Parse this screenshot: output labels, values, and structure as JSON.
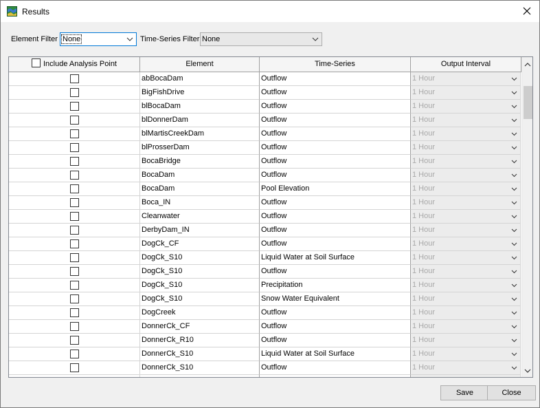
{
  "window": {
    "title": "Results",
    "icon": "hec-hms-app-icon"
  },
  "filters": {
    "element_label": "Element Filter",
    "element_value": "None",
    "timeseries_label": "Time-Series Filter",
    "timeseries_value": "None"
  },
  "table": {
    "headers": {
      "include": "Include Analysis Point",
      "element": "Element",
      "timeseries": "Time-Series",
      "interval": "Output Interval"
    },
    "rows": [
      {
        "element": "abBocaDam",
        "timeseries": "Outflow",
        "interval": "1 Hour"
      },
      {
        "element": "BigFishDrive",
        "timeseries": "Outflow",
        "interval": "1 Hour"
      },
      {
        "element": "blBocaDam",
        "timeseries": "Outflow",
        "interval": "1 Hour"
      },
      {
        "element": "blDonnerDam",
        "timeseries": "Outflow",
        "interval": "1 Hour"
      },
      {
        "element": "blMartisCreekDam",
        "timeseries": "Outflow",
        "interval": "1 Hour"
      },
      {
        "element": "blProsserDam",
        "timeseries": "Outflow",
        "interval": "1 Hour"
      },
      {
        "element": "BocaBridge",
        "timeseries": "Outflow",
        "interval": "1 Hour"
      },
      {
        "element": "BocaDam",
        "timeseries": "Outflow",
        "interval": "1 Hour"
      },
      {
        "element": "BocaDam",
        "timeseries": "Pool Elevation",
        "interval": "1 Hour"
      },
      {
        "element": "Boca_IN",
        "timeseries": "Outflow",
        "interval": "1 Hour"
      },
      {
        "element": "Cleanwater",
        "timeseries": "Outflow",
        "interval": "1 Hour"
      },
      {
        "element": "DerbyDam_IN",
        "timeseries": "Outflow",
        "interval": "1 Hour"
      },
      {
        "element": "DogCk_CF",
        "timeseries": "Outflow",
        "interval": "1 Hour"
      },
      {
        "element": "DogCk_S10",
        "timeseries": "Liquid Water at Soil Surface",
        "interval": "1 Hour"
      },
      {
        "element": "DogCk_S10",
        "timeseries": "Outflow",
        "interval": "1 Hour"
      },
      {
        "element": "DogCk_S10",
        "timeseries": "Precipitation",
        "interval": "1 Hour"
      },
      {
        "element": "DogCk_S10",
        "timeseries": "Snow Water Equivalent",
        "interval": "1 Hour"
      },
      {
        "element": "DogCreek",
        "timeseries": "Outflow",
        "interval": "1 Hour"
      },
      {
        "element": "DonnerCk_CF",
        "timeseries": "Outflow",
        "interval": "1 Hour"
      },
      {
        "element": "DonnerCk_R10",
        "timeseries": "Outflow",
        "interval": "1 Hour"
      },
      {
        "element": "DonnerCk_S10",
        "timeseries": "Liquid Water at Soil Surface",
        "interval": "1 Hour"
      },
      {
        "element": "DonnerCk_S10",
        "timeseries": "Outflow",
        "interval": "1 Hour"
      },
      {
        "element": "",
        "timeseries": "",
        "interval": ""
      }
    ]
  },
  "buttons": {
    "save": "Save",
    "close": "Close"
  }
}
